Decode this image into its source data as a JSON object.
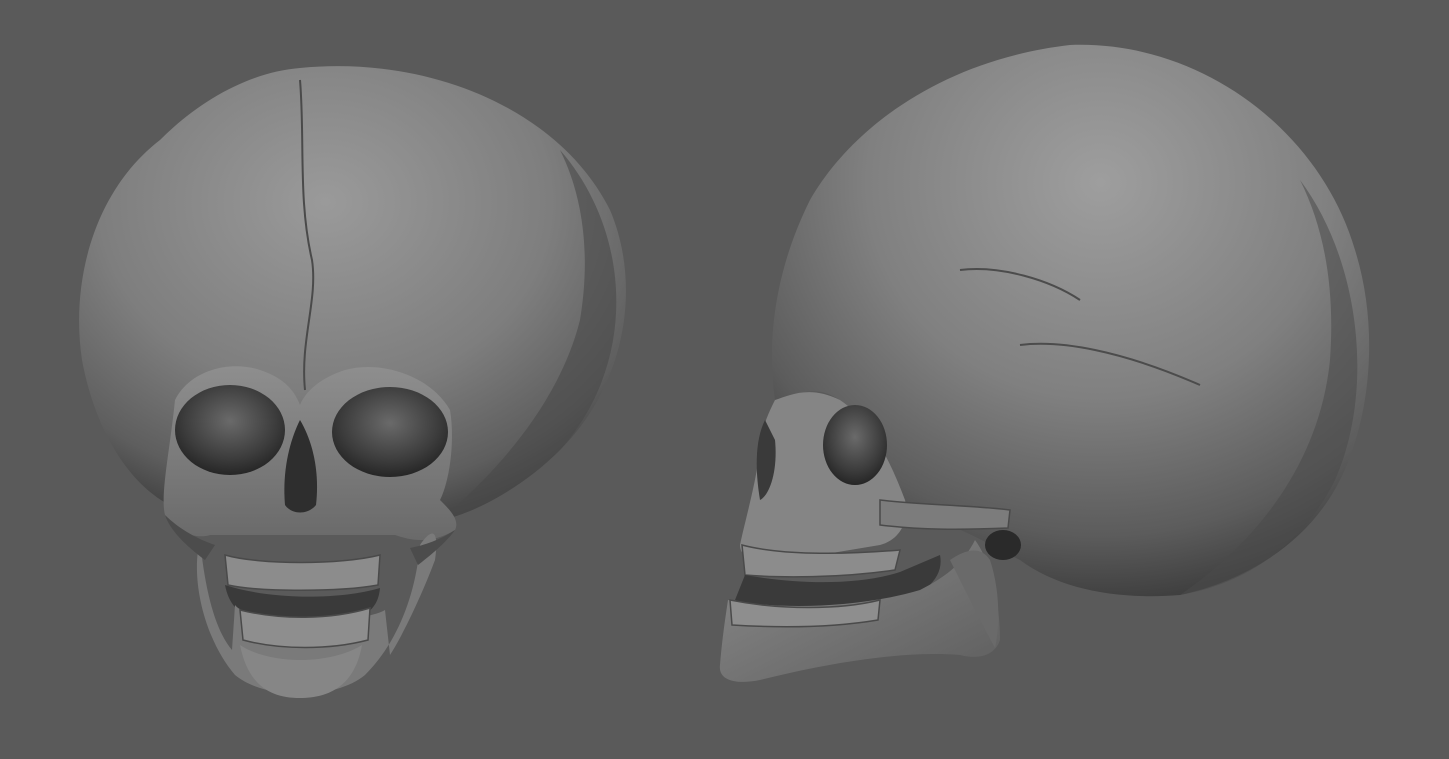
{
  "scene": {
    "background_color": "#5a5a5a",
    "material_color": "#8a8a8a",
    "models": [
      {
        "name": "skull-front-view",
        "view": "front"
      },
      {
        "name": "skull-side-view",
        "view": "side"
      }
    ]
  }
}
